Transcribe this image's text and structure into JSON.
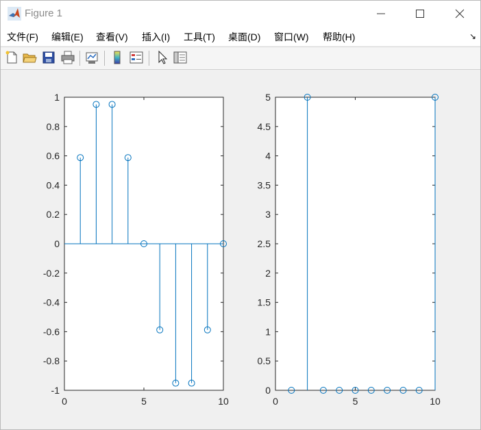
{
  "window": {
    "title": "Figure 1"
  },
  "menu": [
    {
      "label": "文件(F)"
    },
    {
      "label": "编辑(E)"
    },
    {
      "label": "查看(V)"
    },
    {
      "label": "插入(I)"
    },
    {
      "label": "工具(T)"
    },
    {
      "label": "桌面(D)"
    },
    {
      "label": "窗口(W)"
    },
    {
      "label": "帮助(H)"
    }
  ],
  "toolbar_icons": [
    "new-figure-icon",
    "open-folder-icon",
    "save-icon",
    "print-icon",
    "link-plot-icon",
    "colorbar-icon",
    "legend-icon",
    "edit-plot-cursor-icon",
    "property-inspector-icon"
  ],
  "colors": {
    "stem": "#0072bd",
    "axes": "#262626",
    "figure_bg": "#f0f0f0"
  },
  "chart_data": [
    {
      "type": "stem",
      "x": [
        1,
        2,
        3,
        4,
        5,
        6,
        7,
        8,
        9,
        10
      ],
      "values": [
        0.5878,
        0.9511,
        0.9511,
        0.5878,
        0,
        -0.5878,
        -0.9511,
        -0.9511,
        -0.5878,
        0
      ],
      "xlim": [
        0,
        10
      ],
      "ylim": [
        -1,
        1
      ],
      "xticks": [
        "0",
        "5",
        "10"
      ],
      "yticks": [
        "-1",
        "-0.8",
        "-0.6",
        "-0.4",
        "-0.2",
        "0",
        "0.2",
        "0.4",
        "0.6",
        "0.8",
        "1"
      ],
      "grid": false
    },
    {
      "type": "stem",
      "x": [
        1,
        2,
        3,
        4,
        5,
        6,
        7,
        8,
        9,
        10
      ],
      "values": [
        0,
        5,
        0,
        0,
        0,
        0,
        0,
        0,
        0,
        5
      ],
      "xlim": [
        0,
        10
      ],
      "ylim": [
        0,
        5
      ],
      "xticks": [
        "0",
        "5",
        "10"
      ],
      "yticks": [
        "0",
        "0.5",
        "1",
        "1.5",
        "2",
        "2.5",
        "3",
        "3.5",
        "4",
        "4.5",
        "5"
      ],
      "grid": false
    }
  ]
}
